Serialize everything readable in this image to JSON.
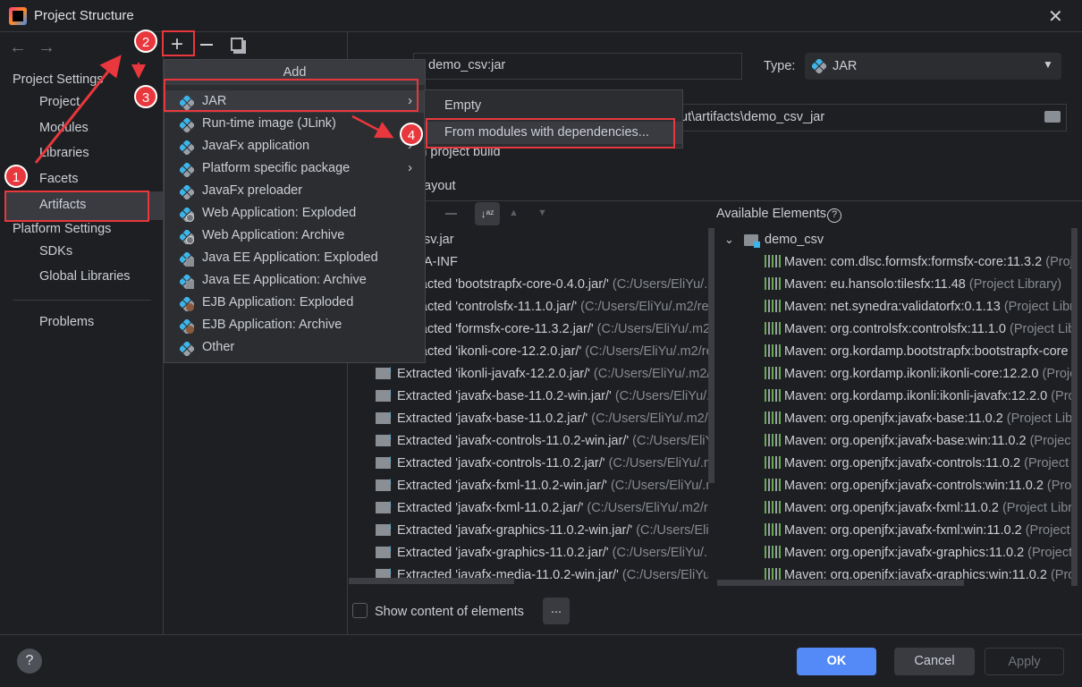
{
  "window": {
    "title": "Project Structure"
  },
  "sidebar": {
    "project_settings": "Project Settings",
    "items": [
      "Project",
      "Modules",
      "Libraries",
      "Facets",
      "Artifacts"
    ],
    "platform_settings": "Platform Settings",
    "platform_items": [
      "SDKs",
      "Global Libraries"
    ],
    "problems": "Problems",
    "selected": "Artifacts"
  },
  "add_menu": {
    "header": "Add",
    "items": [
      {
        "label": "JAR",
        "icon": "jar-icon",
        "submenu": true
      },
      {
        "label": "Run-time image (JLink)",
        "icon": "jar-icon"
      },
      {
        "label": "JavaFx application",
        "icon": "jar-icon",
        "submenu": true
      },
      {
        "label": "Platform specific package",
        "icon": "jar-icon",
        "submenu": true
      },
      {
        "label": "JavaFx preloader",
        "icon": "jar-icon"
      },
      {
        "label": "Web Application: Exploded",
        "icon": "web-app-icon"
      },
      {
        "label": "Web Application: Archive",
        "icon": "web-app-icon"
      },
      {
        "label": "Java EE Application: Exploded",
        "icon": "javaee-icon"
      },
      {
        "label": "Java EE Application: Archive",
        "icon": "javaee-icon"
      },
      {
        "label": "EJB Application: Exploded",
        "icon": "ejb-icon"
      },
      {
        "label": "EJB Application: Archive",
        "icon": "ejb-icon"
      },
      {
        "label": "Other",
        "icon": "jar-icon"
      }
    ]
  },
  "jar_submenu": {
    "items": [
      "Empty",
      "From modules with dependencies..."
    ]
  },
  "artifact": {
    "name": "demo_csv:jar",
    "type_label": "Type:",
    "type_value": "JAR",
    "output_dir": "ut\\artifacts\\demo_csv_jar",
    "include_build": "e in project build",
    "layout_tab": "ayout"
  },
  "layout_tree": [
    {
      "name": "sv.jar",
      "path": ""
    },
    {
      "name": "A-INF",
      "path": ""
    },
    {
      "name": "Extracted 'bootstrapfx-core-0.4.0.jar/'",
      "path": "(C:/Users/EliYu/.m2/re"
    },
    {
      "name": "Extracted 'controlsfx-11.1.0.jar/'",
      "path": "(C:/Users/EliYu/.m2/re"
    },
    {
      "name": "Extracted 'formsfx-core-11.3.2.jar/'",
      "path": "(C:/Users/EliYu/.m2/re"
    },
    {
      "name": "Extracted 'ikonli-core-12.2.0.jar/'",
      "path": "(C:/Users/EliYu/.m2/re"
    },
    {
      "name": "Extracted 'ikonli-javafx-12.2.0.jar/'",
      "path": "(C:/Users/EliYu/.m2/"
    },
    {
      "name": "Extracted 'javafx-base-11.0.2-win.jar/'",
      "path": "(C:/Users/EliYu/."
    },
    {
      "name": "Extracted 'javafx-base-11.0.2.jar/'",
      "path": "(C:/Users/EliYu/.m2/r"
    },
    {
      "name": "Extracted 'javafx-controls-11.0.2-win.jar/'",
      "path": "(C:/Users/EliY"
    },
    {
      "name": "Extracted 'javafx-controls-11.0.2.jar/'",
      "path": "(C:/Users/EliYu/.m"
    },
    {
      "name": "Extracted 'javafx-fxml-11.0.2-win.jar/'",
      "path": "(C:/Users/EliYu/.m"
    },
    {
      "name": "Extracted 'javafx-fxml-11.0.2.jar/'",
      "path": "(C:/Users/EliYu/.m2/r"
    },
    {
      "name": "Extracted 'javafx-graphics-11.0.2-win.jar/'",
      "path": "(C:/Users/Eli"
    },
    {
      "name": "Extracted 'javafx-graphics-11.0.2.jar/'",
      "path": "(C:/Users/EliYu/.m"
    },
    {
      "name": "Extracted 'javafx-media-11.0.2-win.jar/'",
      "path": "(C:/Users/EliYu"
    }
  ],
  "available": {
    "label": "Available Elements",
    "module": "demo_csv",
    "items": [
      {
        "name": "Maven: com.dlsc.formsfx:formsfx-core:11.3.2",
        "scope": "(Proje"
      },
      {
        "name": "Maven: eu.hansolo:tilesfx:11.48",
        "scope": "(Project Library)"
      },
      {
        "name": "Maven: net.synedra:validatorfx:0.1.13",
        "scope": "(Project Libra"
      },
      {
        "name": "Maven: org.controlsfx:controlsfx:11.1.0",
        "scope": "(Project Libr"
      },
      {
        "name": "Maven: org.kordamp.bootstrapfx:bootstrapfx-core",
        "scope": ""
      },
      {
        "name": "Maven: org.kordamp.ikonli:ikonli-core:12.2.0",
        "scope": "(Proje"
      },
      {
        "name": "Maven: org.kordamp.ikonli:ikonli-javafx:12.2.0",
        "scope": "(Pro"
      },
      {
        "name": "Maven: org.openjfx:javafx-base:11.0.2",
        "scope": "(Project Libr"
      },
      {
        "name": "Maven: org.openjfx:javafx-base:win:11.0.2",
        "scope": "(Project"
      },
      {
        "name": "Maven: org.openjfx:javafx-controls:11.0.2",
        "scope": "(Project L"
      },
      {
        "name": "Maven: org.openjfx:javafx-controls:win:11.0.2",
        "scope": "(Proje"
      },
      {
        "name": "Maven: org.openjfx:javafx-fxml:11.0.2",
        "scope": "(Project Libra"
      },
      {
        "name": "Maven: org.openjfx:javafx-fxml:win:11.0.2",
        "scope": "(Project L"
      },
      {
        "name": "Maven: org.openjfx:javafx-graphics:11.0.2",
        "scope": "(Project"
      },
      {
        "name": "Maven: org.openjfx:javafx-graphics:win:11.0.2",
        "scope": "(Proj"
      }
    ]
  },
  "bottom": {
    "show_content": "Show content of elements",
    "show_content_checked": false,
    "more": "..."
  },
  "footer": {
    "help": "?",
    "ok": "OK",
    "cancel": "Cancel",
    "apply": "Apply"
  },
  "annotations": [
    "1",
    "2",
    "3",
    "4"
  ],
  "colors": {
    "accent": "#548af7",
    "annotation": "#e8383d",
    "jar_icon": "#3fb4e8"
  }
}
